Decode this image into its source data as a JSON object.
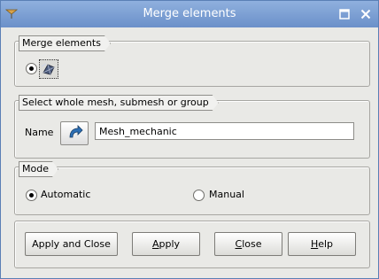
{
  "window": {
    "title": "Merge elements"
  },
  "icons": {
    "window_menu": "pin-icon",
    "maximize": "maximize-icon",
    "close": "close-icon",
    "algorithm": "merge-elements-icon",
    "select": "arrow-select-icon"
  },
  "groups": {
    "algorithm": {
      "title": "Merge elements",
      "selected": true
    },
    "source": {
      "title": "Select whole mesh, submesh or group",
      "name_label": "Name",
      "name_value": "Mesh_mechanic"
    },
    "mode": {
      "title": "Mode",
      "options": [
        {
          "label": "Automatic",
          "checked": true
        },
        {
          "label": "Manual",
          "checked": false
        }
      ]
    }
  },
  "buttons": {
    "apply_close": "Apply and Close",
    "apply": {
      "mnemonic": "A",
      "rest": "pply"
    },
    "close": {
      "mnemonic": "C",
      "rest": "lose"
    },
    "help": {
      "mnemonic": "H",
      "rest": "elp"
    }
  },
  "colors": {
    "titlebar": "#6b90c9",
    "title_text": "#ffffff",
    "window_bg": "#e9e9e6"
  }
}
